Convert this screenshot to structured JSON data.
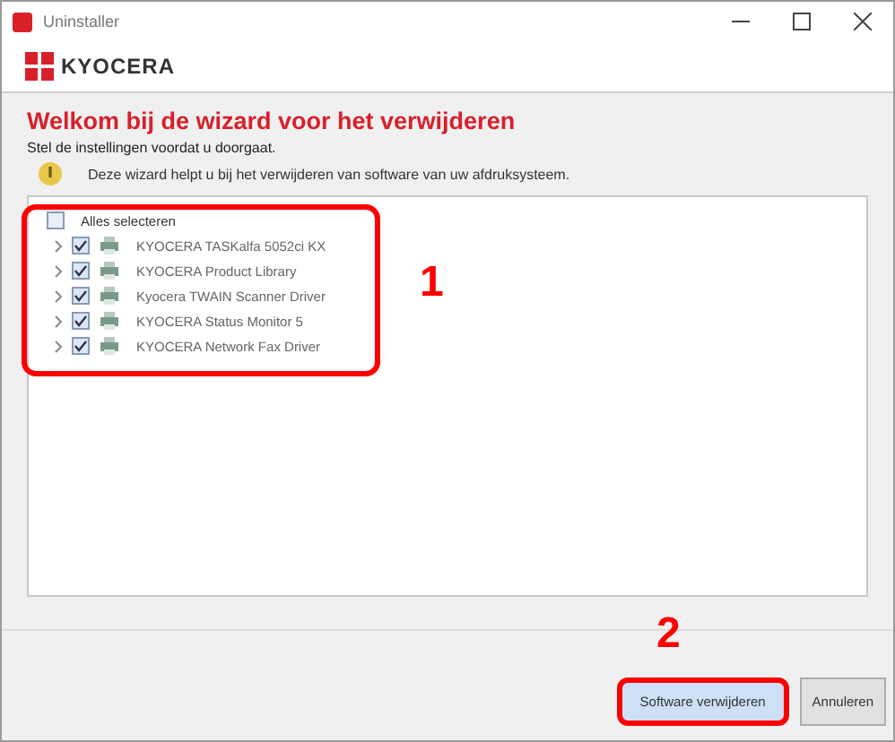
{
  "window": {
    "title": "Uninstaller"
  },
  "logo": {
    "text": "KYOCERA"
  },
  "heading": "Welkom bij de wizard voor het verwijderen",
  "subtitle": "Stel de instellingen voordat u doorgaat.",
  "info": "Deze wizard helpt u bij het verwijderen van software van uw afdruksysteem.",
  "tree": {
    "label": "Alles selecteren",
    "checked": false,
    "children": [
      {
        "label": "KYOCERA TASKalfa 5052ci KX",
        "checked": true
      },
      {
        "label": "KYOCERA Product Library",
        "checked": true
      },
      {
        "label": "Kyocera TWAIN Scanner Driver",
        "checked": true
      },
      {
        "label": "KYOCERA Status Monitor 5",
        "checked": true
      },
      {
        "label": "KYOCERA Network Fax Driver",
        "checked": true
      }
    ]
  },
  "callouts": [
    "1",
    "2"
  ],
  "buttons": [
    {
      "label": "Software verwijderen",
      "kind": "primary"
    },
    {
      "label": "Annuleren",
      "kind": "secondary"
    }
  ]
}
